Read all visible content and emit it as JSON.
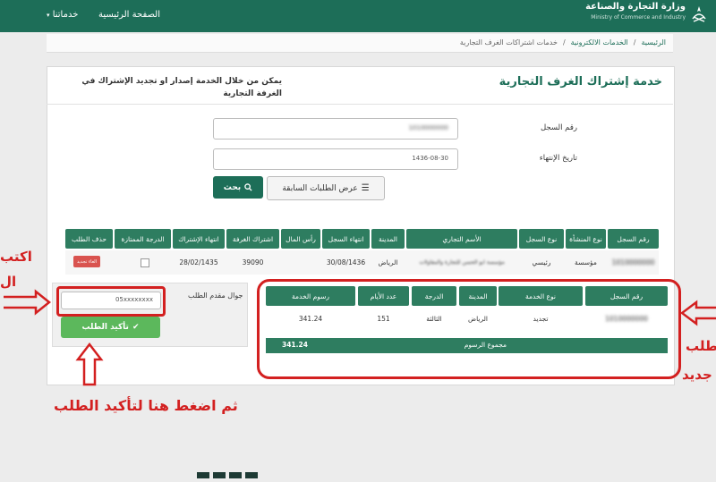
{
  "header": {
    "ministry_ar": "وزارة التجارة والصناعة",
    "ministry_en": "Ministry of Commerce and Industry",
    "nav_home": "الصفحة الرئيسية",
    "nav_services": "خدماتنا"
  },
  "breadcrumb": [
    "الرئيسية",
    "الخدمات الالكترونية",
    "خدمات اشتراكات الغرف التجارية"
  ],
  "page": {
    "title": "خدمة إشتراك الغرف التجارية",
    "description": "يمكن من خلال الخدمة إصدار او تجديد الإشتراك في الغرفة التجارية"
  },
  "form": {
    "cr_label": "رقم السجل",
    "cr_value": "1010000000",
    "expiry_label": "تاريخ الإنتهاء",
    "expiry_value": "1436-08-30",
    "search_button": "بحث",
    "prev_requests_button": "عرض الطلبات السابقة"
  },
  "results_table": {
    "headers": [
      "رقم السجل",
      "نوع المنشأة",
      "نوع السجل",
      "الأسم التجاري",
      "المدينة",
      "انتهاء السجل",
      "رأس المال",
      "اشتراك الغرفة",
      "انتهاء الإشتراك",
      "الدرجة الممتازة",
      "حذف الطلب"
    ],
    "row": [
      "1010000000",
      "مؤسسة",
      "رئيسي",
      "مؤسسة ابو الحسن للتجارة والمقاولات",
      "الرياض",
      "30/08/1436",
      "",
      "39090",
      "28/02/1435",
      "",
      "الغاء تجديد"
    ]
  },
  "phone": {
    "label": "جوال مقدم الطلب",
    "value": "05xxxxxxxx",
    "confirm_button": "تأكيد الطلب"
  },
  "fees_table": {
    "headers": [
      "رقم السجل",
      "نوع الخدمة",
      "المدينة",
      "الدرجة",
      "عدد الأيام",
      "رسوم الخدمة"
    ],
    "row": [
      "1010000000",
      "تجديد",
      "الرياض",
      "الثالثة",
      "151",
      "341.24"
    ],
    "total_label": "مجموع الرسوم",
    "total_value": "341.24"
  },
  "annotations": {
    "bottom": "ثم اضغط هنا لتأكيد الطلب",
    "left_top": "اكتب",
    "left_mid": "ال",
    "right_top": "طلب",
    "right_bottom": "جديد"
  },
  "colors": {
    "brand_green": "#1d6e58",
    "table_header": "#2e7d60",
    "confirm_green": "#5cb85c",
    "annotation_red": "#d32020",
    "cancel_red": "#d9534f"
  }
}
